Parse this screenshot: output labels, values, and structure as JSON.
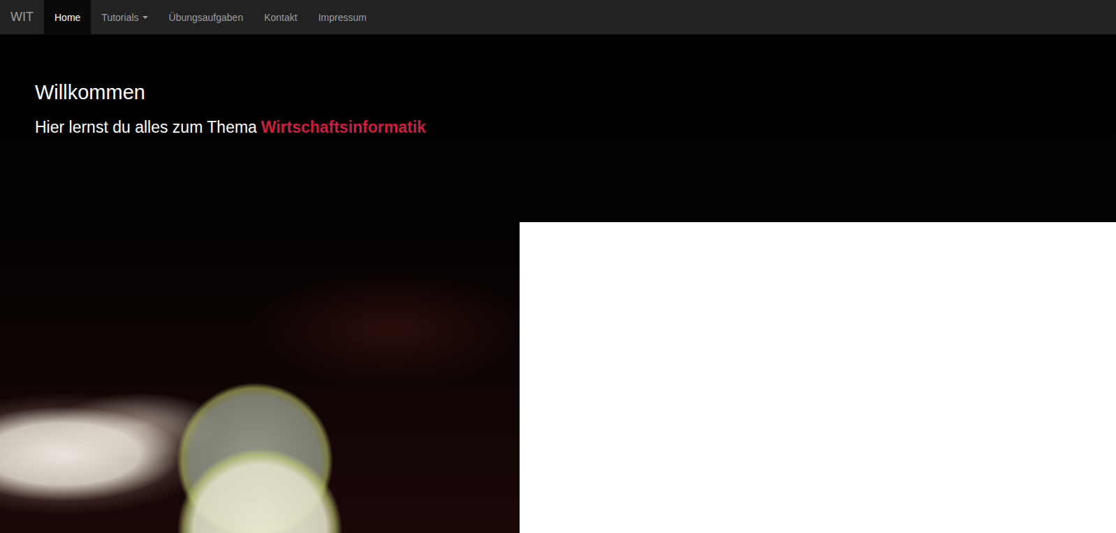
{
  "navbar": {
    "brand": "WIT",
    "items": [
      {
        "label": "Home",
        "selected": true,
        "dropdown": false
      },
      {
        "label": "Tutorials",
        "selected": false,
        "dropdown": true
      },
      {
        "label": "Übungsaufgaben",
        "selected": false,
        "dropdown": false
      },
      {
        "label": "Kontakt",
        "selected": false,
        "dropdown": false
      },
      {
        "label": "Impressum",
        "selected": false,
        "dropdown": false
      }
    ]
  },
  "hero": {
    "title": "Willkommen",
    "subtitle": "Hier lernst du alles zum Thema",
    "highlight": "Wirtschaftsinformatik"
  }
}
